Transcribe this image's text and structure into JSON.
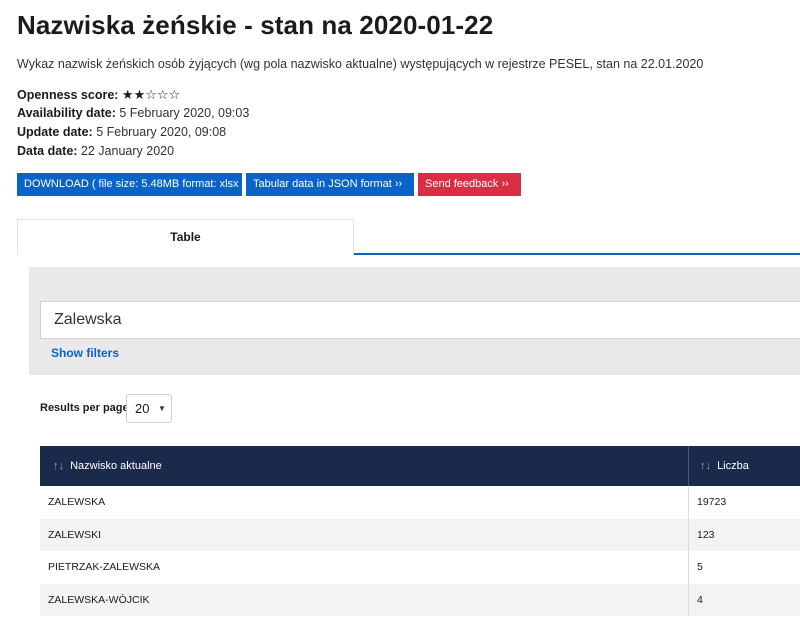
{
  "header": {
    "title": "Nazwiska żeńskie - stan na 2020-01-22",
    "description": "Wykaz nazwisk żeńskich osób żyjących (wg pola nazwisko aktualne) występujących w rejestrze PESEL, stan na 22.01.2020"
  },
  "meta": {
    "openness_label": "Openness score:",
    "openness_stars": "★★☆☆☆",
    "openness_score": 2,
    "availability_label": "Availability date:",
    "availability_value": "5 February 2020, 09:03",
    "update_label": "Update date:",
    "update_value": "5 February 2020, 09:08",
    "data_label": "Data date:",
    "data_value": "22 January 2020"
  },
  "actions": {
    "download": "DOWNLOAD ( file size: 5.48MB format: xlsx )",
    "json": "Tabular data in JSON format ››",
    "feedback": "Send feedback ››"
  },
  "tabs": [
    {
      "label": "Table"
    }
  ],
  "filters": {
    "search_value": "Zalewska",
    "show_filters": "Show filters"
  },
  "pagination": {
    "results_label": "Results per page:",
    "results_value": "20"
  },
  "table": {
    "columns": [
      "Nazwisko aktualne",
      "Liczba"
    ],
    "rows": [
      [
        "ZALEWSKA",
        "19723"
      ],
      [
        "ZALEWSKI",
        "123"
      ],
      [
        "PIETRZAK-ZALEWSKA",
        "5"
      ],
      [
        "ZALEWSKA-WÓJCIK",
        "4"
      ]
    ]
  },
  "colors": {
    "primary": "#0a63c9",
    "danger": "#d92e43",
    "table_header": "#1b2a4a"
  }
}
